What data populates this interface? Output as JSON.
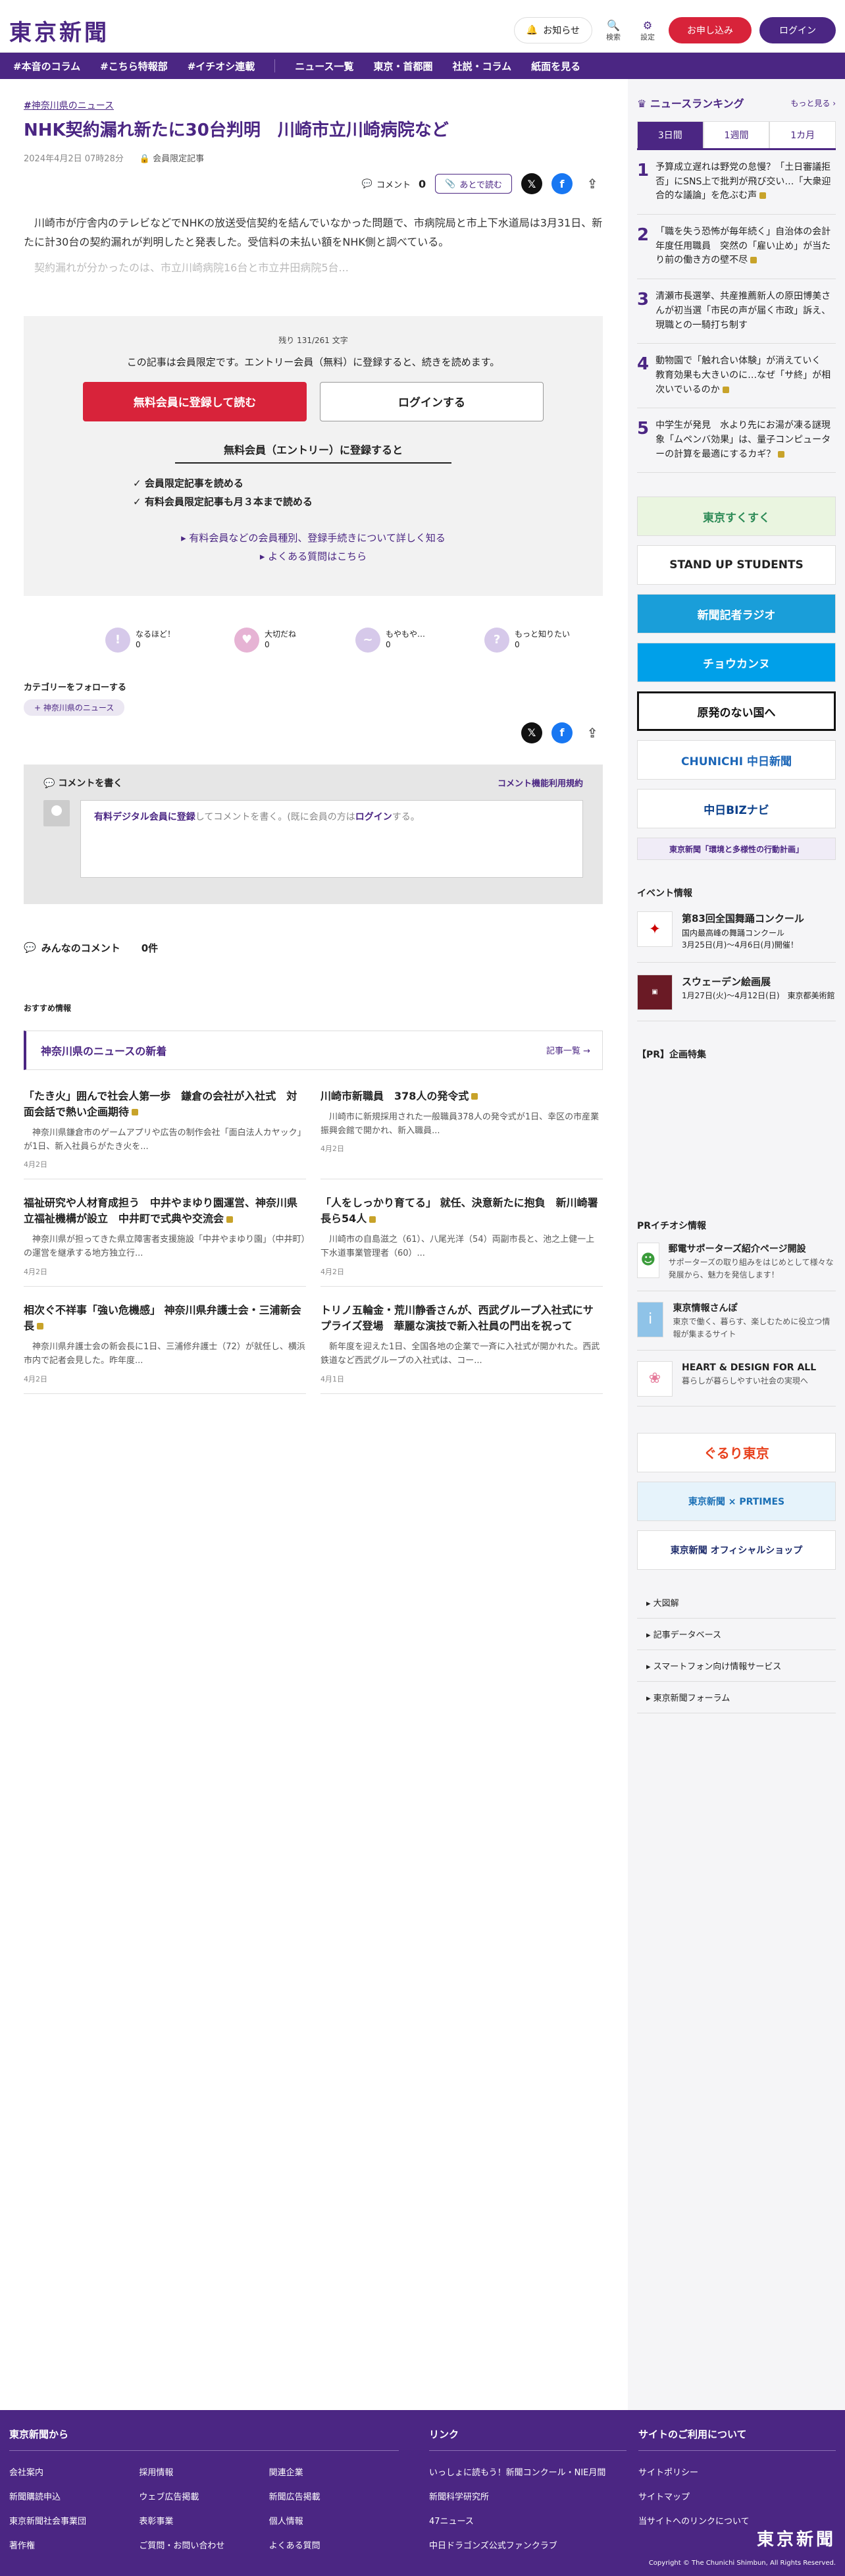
{
  "header": {
    "logo": "東京新聞",
    "notify_label": "お知らせ",
    "search_label": "検索",
    "settings_label": "設定",
    "apply_label": "お申し込み",
    "login_label": "ログイン"
  },
  "nav": [
    "#本音のコラム",
    "#こちら特報部",
    "#イチオシ連載",
    "ニュース一覧",
    "東京・首都圏",
    "社説・コラム",
    "紙面を見る"
  ],
  "article": {
    "region": "神奈川県のニュース",
    "title": "NHK契約漏れ新たに30台判明　川崎市立川崎病院など",
    "date": "2024年4月2日 07時28分",
    "member": "会員限定記事",
    "comment_label": "コメント",
    "comment_count": "0",
    "later_label": "あとで読む",
    "body": "川崎市が庁舎内のテレビなどでNHKの放送受信契約を結んでいなかった問題で、市病院局と市上下水道局は3月31日、新たに計30台の契約漏れが判明したと発表した。受信料の未払い額をNHK側と調べている。",
    "fade": "契約漏れが分かったのは、市立川崎病院16台と市立井田病院5台..."
  },
  "paywall": {
    "remaining": "残り 131/261 文字",
    "note": "この記事は会員限定です。エントリー会員（無料）に登録すると、続きを読めます。",
    "register_btn": "無料会員に登録して読む",
    "login_btn": "ログインする",
    "subtitle": "無料会員（エントリー）に登録すると",
    "benefit1": "会員限定記事を読める",
    "benefit2": "有料会員限定記事も月３本まで読める",
    "link1": "有料会員などの会員種別、登録手続きについて詳しく知る",
    "link2": "よくある質問はこちら"
  },
  "reactions": [
    {
      "label": "なるほど！",
      "count": "0"
    },
    {
      "label": "大切だね",
      "count": "0"
    },
    {
      "label": "もやもや…",
      "count": "0"
    },
    {
      "label": "もっと知りたい",
      "count": "0"
    }
  ],
  "category": {
    "label": "カテゴリーをフォローする",
    "tag": "神奈川県のニュース"
  },
  "comment_box": {
    "title": "コメントを書く",
    "rules": "コメント機能利用規約",
    "placeholder_link": "有料デジタル会員に登録",
    "placeholder_text": "してコメントを書く。(既に会員の方は",
    "placeholder_login": "ログイン",
    "placeholder_end": "する。"
  },
  "all_comments": {
    "label": "みんなのコメント",
    "count": "0件"
  },
  "recommend": "おすすめ情報",
  "news_section": {
    "title": "神奈川県のニュースの新着",
    "more": "記事一覧"
  },
  "news": [
    {
      "title": "「たき火」囲んで社会人第一歩　鎌倉の会社が入社式　対面会話で熱い企画期待",
      "summary": "神奈川県鎌倉市のゲームアプリや広告の制作会社「面白法人カヤック」が1日、新入社員らがたき火を...",
      "date": "4月2日"
    },
    {
      "title": "川崎市新職員　378人の発令式",
      "summary": "川崎市に新規採用された一般職員378人の発令式が1日、幸区の市産業振興会館で開かれ、新入職員...",
      "date": "4月2日"
    },
    {
      "title": "福祉研究や人材育成担う　中井やまゆり園運営、神奈川県立福祉機構が設立　中井町で式典や交流会",
      "summary": "神奈川県が担ってきた県立障害者支援施設「中井やまゆり園」（中井町）の運営を継承する地方独立行...",
      "date": "4月2日"
    },
    {
      "title": "「人をしっかり育てる」 就任、決意新たに抱負　新川崎署長ら54人",
      "summary": "川崎市の自島滋之（61）、八尾光洋（54）両副市長と、池之上健一上下水道事業管理者（60）...",
      "date": "4月2日"
    },
    {
      "title": "相次ぐ不祥事「強い危機感」 神奈川県弁護士会・三浦新会長",
      "summary": "神奈川県弁護士会の新会長に1日、三浦修弁護士（72）が就任し、横浜市内で記者会見した。昨年度...",
      "date": "4月2日"
    },
    {
      "title": "トリノ五輪金・荒川静香さんが、西武グループ入社式にサプライズ登場　華麗な演技で新入社員の門出を祝って",
      "summary": "新年度を迎えた1日、全国各地の企業で一斉に入社式が開かれた。西武鉄道など西武グループの入社式は、コー...",
      "date": "4月1日"
    }
  ],
  "ranking": {
    "title": "ニュースランキング",
    "more": "もっと見る",
    "tabs": [
      "3日間",
      "1週間",
      "1カ月"
    ],
    "items": [
      "予算成立遅れは野党の怠慢？「土日審議拒否」にSNS上で批判が飛び交い…「大衆迎合的な議論」を危ぶむ声",
      "「職を失う恐怖が毎年続く」自治体の会計年度任用職員　突然の「雇い止め」が当たり前の働き方の壁不尽",
      "清瀬市長選挙、共産推薦新人の原田博美さんが初当選「市民の声が届く市政」訴え、現職との一騎打ち制す",
      "動物園で「触れ合い体験」が消えていく　教育効果も大きいのに…なぜ「サ終」が相次いでいるのか",
      "中学生が発見　水より先にお湯が凍る謎現象「ムペンバ効果」は、量子コンピューターの計算を最適にするカギ？"
    ]
  },
  "banners": [
    "東京すくすく",
    "STAND UP STUDENTS",
    "新聞記者ラジオ",
    "チョウカンヌ",
    "原発のない国へ",
    "CHUNICHI 中日新聞",
    "中日BIZナビ",
    "東京新聞「環境と多様性の行動計画」"
  ],
  "events": {
    "title": "イベント情報",
    "items": [
      {
        "name": "第83回全国舞踊コンクール",
        "desc": "国内最高峰の舞踊コンクール",
        "date": "3月25日(月)〜4月6日(月)開催！"
      },
      {
        "name": "スウェーデン絵画展",
        "desc": "1月27日(火)〜4月12日(日)　東京都美術館",
        "date": ""
      }
    ]
  },
  "pr_title": "【PR】企画特集",
  "pr_info": {
    "title": "PRイチオシ情報",
    "items": [
      {
        "name": "郵電サポーターズ紹介ページ開設",
        "desc": "サポーターズの取り組みをはじめとして様々な発展から、魅力を発信します！"
      },
      {
        "name": "東京情報さんぽ",
        "desc": "東京で働く、暮らす、楽しむために役立つ情報が集まるサイト"
      },
      {
        "name": "HEART & DESIGN FOR ALL",
        "desc": "暮らしが暮らしやすい社会の実現へ"
      }
    ]
  },
  "banners2": [
    "ぐるり東京",
    "東京新聞 × PRTIMES",
    "東京新聞 オフィシャルショップ"
  ],
  "side_links": [
    "大図解",
    "記事データベース",
    "スマートフォン向け情報サービス",
    "東京新聞フォーラム"
  ],
  "footer": {
    "col1_title": "東京新聞から",
    "col1": [
      "会社案内",
      "採用情報",
      "関連企業",
      "新聞購読申込",
      "ウェブ広告掲載",
      "新聞広告掲載",
      "東京新聞社会事業団",
      "表彰事業",
      "個人情報",
      "著作権",
      "ご質問・お問い合わせ",
      "よくある質問"
    ],
    "col2_title": "リンク",
    "col2": [
      "いっしょに読もう！新聞コンクール・NIE月間",
      "新聞科学研究所",
      "47ニュース",
      "中日ドラゴンズ公式ファンクラブ"
    ],
    "col3_title": "サイトのご利用について",
    "col3": [
      "サイトポリシー",
      "サイトマップ",
      "当サイトへのリンクについて"
    ],
    "logo": "東京新聞",
    "copyright": "Copyright © The Chunichi Shimbun, All Rights Reserved."
  }
}
